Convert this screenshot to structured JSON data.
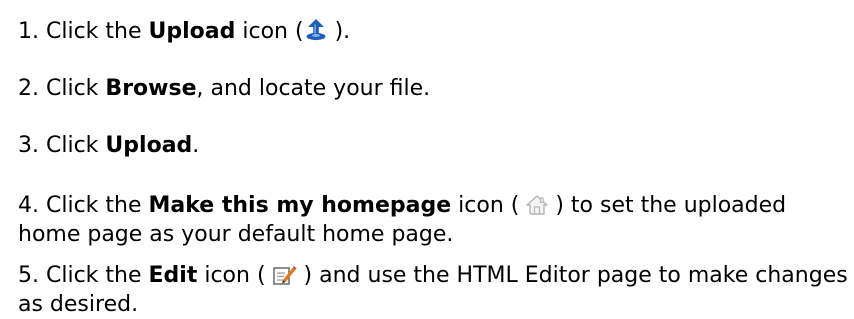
{
  "steps": [
    {
      "num": "1.",
      "pre": " Click the ",
      "bold": "Upload",
      "mid": " icon (",
      "icon": "upload-icon",
      "post": " )."
    },
    {
      "num": "2.",
      "pre": " Click ",
      "bold": "Browse",
      "post": ", and locate your file."
    },
    {
      "num": "3.",
      "pre": " Click ",
      "bold": "Upload",
      "post": "."
    },
    {
      "num": "4.",
      "pre": " Click the ",
      "bold": "Make this my homepage",
      "mid": " icon ( ",
      "icon": "home-icon",
      "post": "  ) to set the uploaded home page as your default home page."
    },
    {
      "num": "5.",
      "pre": " Click the ",
      "bold": "Edit",
      "mid": " icon ( ",
      "icon": "edit-icon",
      "post": " ) and use the HTML Editor page to make changes as desired."
    }
  ],
  "colors": {
    "text": "#000000",
    "upload_icon_blue": "#1f5fb4",
    "home_icon_gray": "#b5b5b5",
    "edit_icon_orange": "#e07a1f"
  }
}
